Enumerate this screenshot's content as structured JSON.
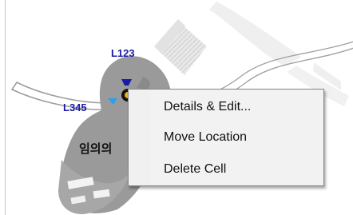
{
  "map": {
    "markers": [
      {
        "label": "L123",
        "icon": "cell-direction-icon",
        "color": "#1a1aa6"
      },
      {
        "label": "L345",
        "icon": "cell-direction-icon",
        "color": "#2aa0e8"
      }
    ],
    "place_label": "임의의",
    "center_icon": "cell-site-icon"
  },
  "context_menu": {
    "items": [
      {
        "label": "Details & Edit..."
      },
      {
        "label": "Move Location"
      },
      {
        "label": "Delete Cell"
      }
    ]
  },
  "colors": {
    "map_background": "#ffffff",
    "cell_area": "#9a9a9a",
    "building_gray": "#d8d8d8",
    "road_outline": "#9e9e9e",
    "menu_background": "#f2f2f2",
    "menu_border": "#828282",
    "label_blue": "#1a1aa6"
  }
}
